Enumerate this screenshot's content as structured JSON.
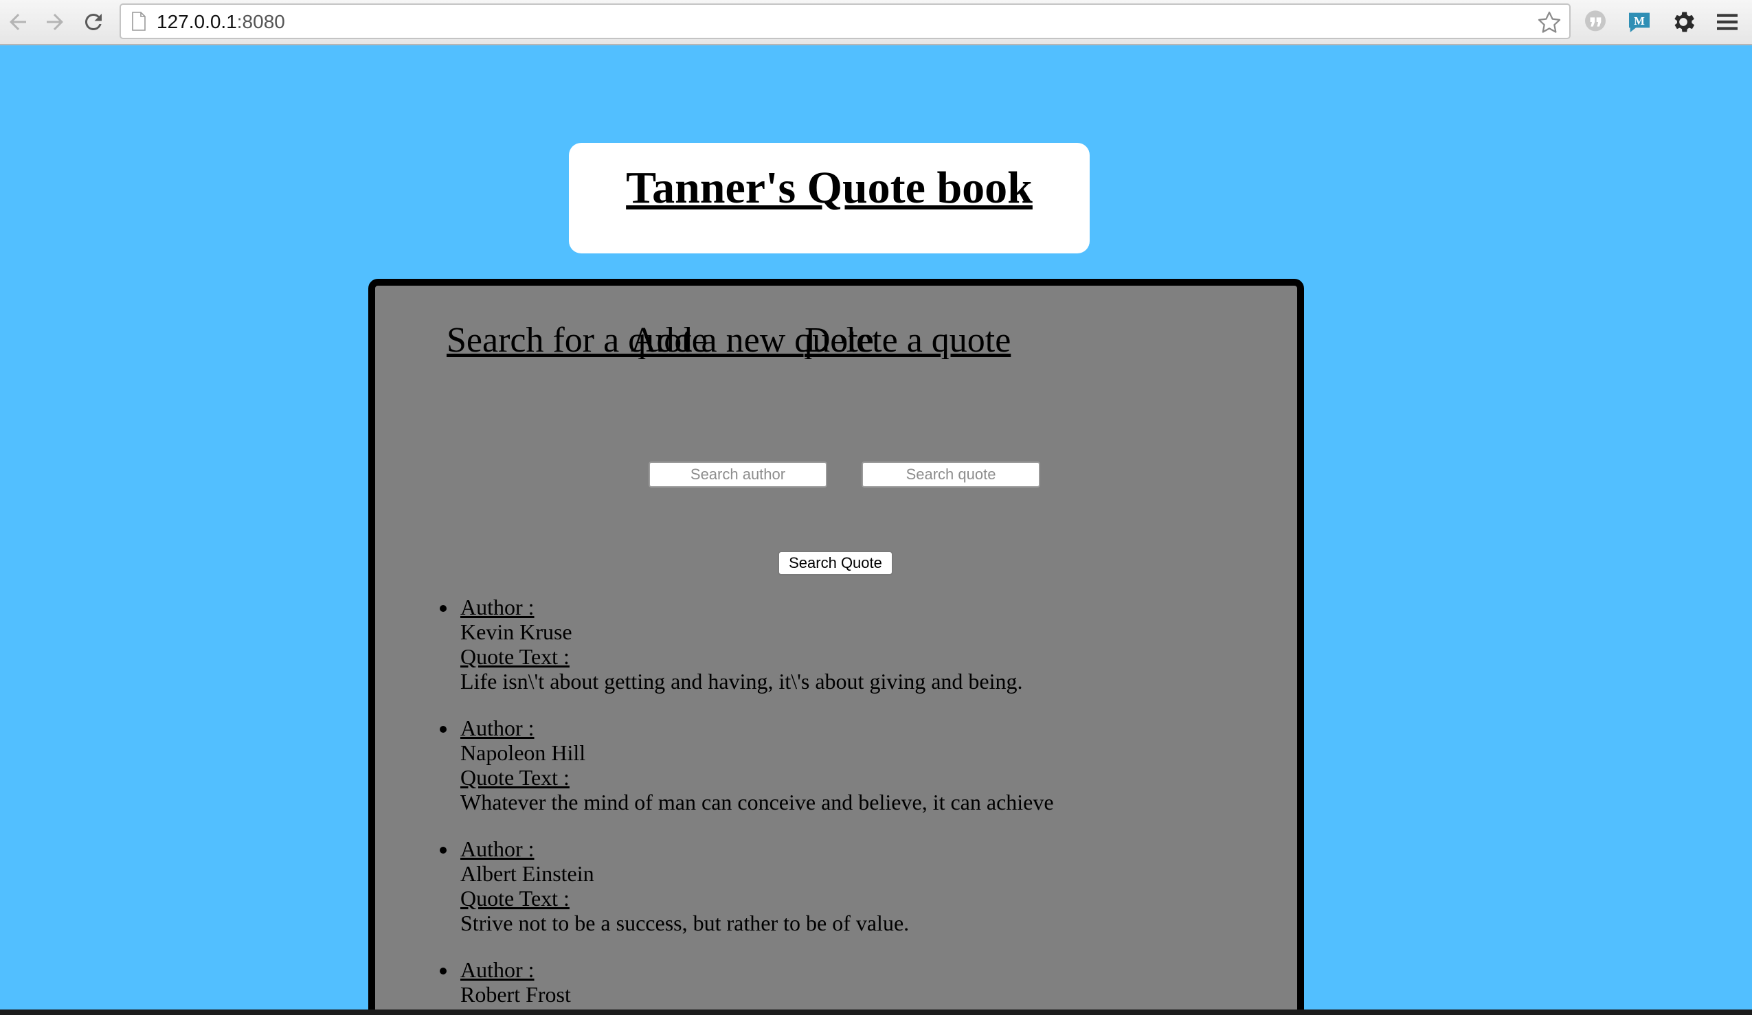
{
  "browser": {
    "url_host": "127.0.0.1",
    "url_port": ":8080"
  },
  "header": {
    "title": "Tanner's Quote book"
  },
  "nav": {
    "search": "Search for a quote",
    "add": "Add a new quote",
    "delete": "Delete a quote"
  },
  "search": {
    "author_placeholder": "Search author",
    "quote_placeholder": "Search quote",
    "button_label": "Search Quote"
  },
  "labels": {
    "author": "Author :",
    "quote_text": "Quote Text :"
  },
  "quotes": [
    {
      "author": "Kevin Kruse",
      "text": "Life isn\\'t about getting and having, it\\'s about giving and being."
    },
    {
      "author": "Napoleon Hill",
      "text": "Whatever the mind of man can conceive and believe, it can achieve"
    },
    {
      "author": "Albert Einstein",
      "text": "Strive not to be a success, but rather to be of value."
    },
    {
      "author": "Robert Frost",
      "text": ""
    }
  ],
  "colors": {
    "page_background": "#52bfff",
    "panel_background": "#808080",
    "panel_border": "#000000",
    "header_background": "#ffffff"
  }
}
